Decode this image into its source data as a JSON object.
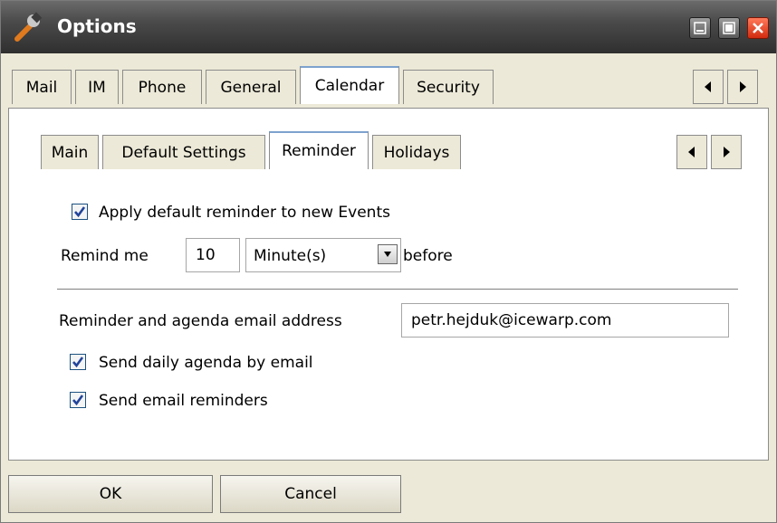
{
  "window": {
    "title": "Options"
  },
  "outer_tabs": [
    {
      "label": "Mail"
    },
    {
      "label": "IM"
    },
    {
      "label": "Phone"
    },
    {
      "label": "General"
    },
    {
      "label": "Calendar"
    },
    {
      "label": "Security"
    }
  ],
  "outer_active_tab": "Calendar",
  "inner_tabs": [
    {
      "label": "Main"
    },
    {
      "label": "Default Settings"
    },
    {
      "label": "Reminder"
    },
    {
      "label": "Holidays"
    }
  ],
  "inner_active_tab": "Reminder",
  "reminder": {
    "apply_default_label": "Apply default reminder to new Events",
    "apply_default_checked": true,
    "remind_me_label": "Remind me",
    "remind_value": "10",
    "unit_selected": "Minute(s)",
    "before_label": "before",
    "email_label": "Reminder and agenda email address",
    "email_value": "petr.hejduk@icewarp.com",
    "daily_agenda_label": "Send daily agenda by email",
    "daily_agenda_checked": true,
    "email_reminders_label": "Send email reminders",
    "email_reminders_checked": true
  },
  "buttons": {
    "ok_label": "OK",
    "cancel_label": "Cancel"
  },
  "icons": {
    "title_icon": "wrench-icon",
    "minimize": "minimize-icon",
    "maximize": "maximize-icon",
    "close": "close-icon"
  },
  "colors": {
    "titlebar": "#3c3c3c",
    "dialog_bg": "#ece9d8",
    "close_button": "#d22b0e",
    "checkbox_mark": "#21449b"
  }
}
